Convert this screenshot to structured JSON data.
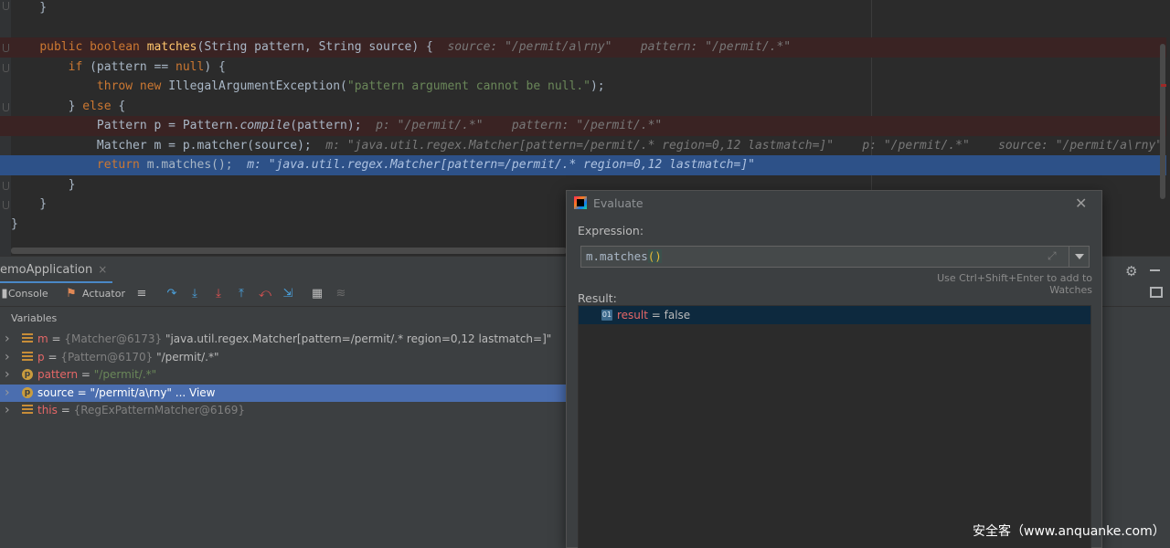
{
  "editor": {
    "lines": [
      {
        "segments": [
          {
            "t": "    }",
            "c": ""
          }
        ]
      },
      {
        "segments": []
      },
      {
        "segments": [
          {
            "t": "    ",
            "c": ""
          },
          {
            "t": "public boolean ",
            "c": "kw"
          },
          {
            "t": "matches",
            "c": "fn"
          },
          {
            "t": "(String pattern, String source) {  ",
            "c": ""
          },
          {
            "t": "source: \"/permit/a\\rny\"    pattern: \"/permit/.*\"",
            "c": "hint"
          }
        ]
      },
      {
        "segments": [
          {
            "t": "        ",
            "c": ""
          },
          {
            "t": "if ",
            "c": "kw"
          },
          {
            "t": "(pattern == ",
            "c": ""
          },
          {
            "t": "null",
            "c": "kw"
          },
          {
            "t": ") {",
            "c": ""
          }
        ]
      },
      {
        "segments": [
          {
            "t": "            ",
            "c": ""
          },
          {
            "t": "throw new ",
            "c": "kw"
          },
          {
            "t": "IllegalArgumentException(",
            "c": ""
          },
          {
            "t": "\"pattern argument cannot be null.\"",
            "c": "str"
          },
          {
            "t": ");",
            "c": ""
          }
        ]
      },
      {
        "segments": [
          {
            "t": "        } ",
            "c": ""
          },
          {
            "t": "else ",
            "c": "kw"
          },
          {
            "t": "{",
            "c": ""
          }
        ]
      },
      {
        "segments": [
          {
            "t": "            Pattern p = Pattern.",
            "c": ""
          },
          {
            "t": "compile",
            "c": "it"
          },
          {
            "t": "(pattern);  ",
            "c": ""
          },
          {
            "t": "p: \"/permit/.*\"    pattern: \"/permit/.*\"",
            "c": "hint"
          }
        ]
      },
      {
        "segments": [
          {
            "t": "            Matcher m = p.matcher(source);  ",
            "c": ""
          },
          {
            "t": "m: \"java.util.regex.Matcher[pattern=/permit/.* region=0,12 lastmatch=]\"    p: \"/permit/.*\"    source: \"/permit/a\\rny\"",
            "c": "hint"
          }
        ]
      },
      {
        "segments": [
          {
            "t": "            ",
            "c": ""
          },
          {
            "t": "return ",
            "c": "kw"
          },
          {
            "t": "m.matches();  ",
            "c": ""
          },
          {
            "t": "m: \"java.util.regex.Matcher[pattern=/permit/.* region=0,12 lastmatch=]\"",
            "c": "hint"
          }
        ]
      },
      {
        "segments": [
          {
            "t": "        }",
            "c": ""
          }
        ]
      },
      {
        "segments": [
          {
            "t": "    }",
            "c": ""
          }
        ]
      },
      {
        "segments": [
          {
            "t": "}",
            "c": ""
          }
        ]
      }
    ]
  },
  "debug": {
    "session_tab": "emoApplication",
    "session_close": "×",
    "toolbar": {
      "console": "Console",
      "actuator": "Actuator"
    },
    "vars_header": "Variables",
    "variables": [
      {
        "icon": "field",
        "name": "m",
        "eq": " = ",
        "type": "{Matcher@6173} ",
        "value": "\"java.util.regex.Matcher[pattern=/permit/.* region=0,12 lastmatch=]\"",
        "value_class": ""
      },
      {
        "icon": "field",
        "name": "p",
        "eq": " = ",
        "type": "{Pattern@6170} ",
        "value": "\"/permit/.*\"",
        "value_class": ""
      },
      {
        "icon": "param",
        "name": "pattern",
        "eq": " = ",
        "type": "",
        "value": "\"/permit/.*\"",
        "value_class": "vstr"
      },
      {
        "icon": "param",
        "name": "source",
        "eq": " = ",
        "type": "",
        "value": "\"/permit/a\\rny\" ... View",
        "value_class": ""
      },
      {
        "icon": "field",
        "name": "this",
        "eq": " = ",
        "type": "{RegExPatternMatcher@6169}",
        "value": "",
        "value_class": ""
      }
    ]
  },
  "dialog": {
    "title": "Evaluate",
    "close": "✕",
    "expression_label": "Expression:",
    "expression_prefix": "m.matches",
    "expression_parens": "()",
    "watch_hint": "Use Ctrl+Shift+Enter to add to Watches",
    "result_label": "Result:",
    "result_icon": "01",
    "result_name": "result",
    "result_rest": " = false"
  },
  "watermark": "安全客（www.anquanke.com）",
  "colors": {
    "keyword": "#cc7832",
    "method": "#ffc66d",
    "string": "#6a8759",
    "exec_line": "#2d5188",
    "breakpoint_line": "#3a2323",
    "selection": "#4b6eaf"
  }
}
